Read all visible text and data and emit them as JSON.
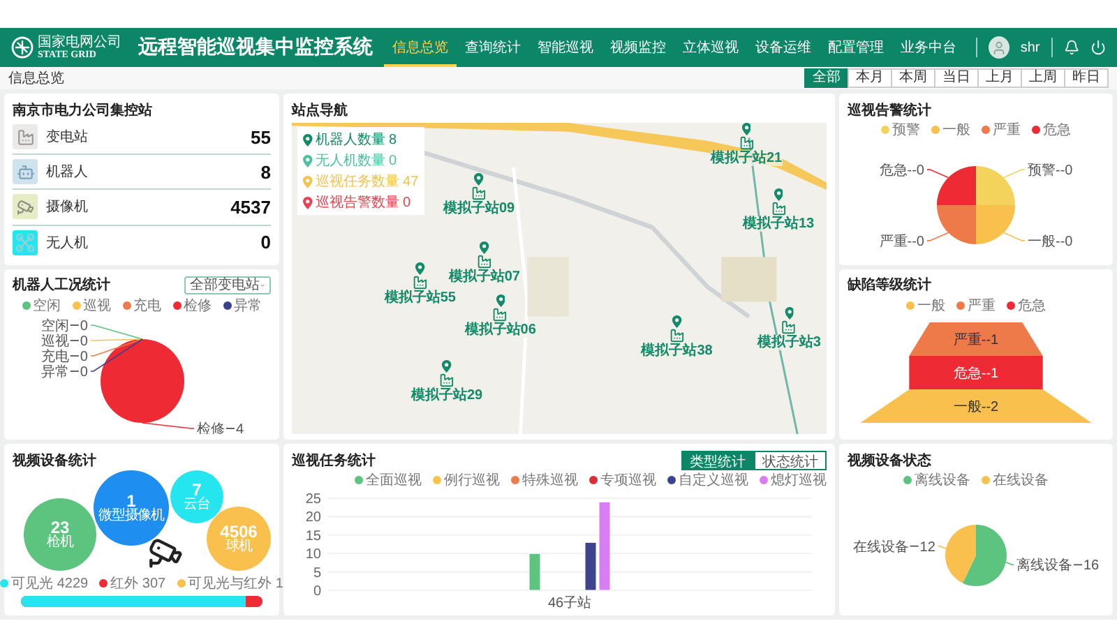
{
  "header": {
    "logo_cn": "国家电网公司",
    "logo_en": "STATE GRID",
    "title": "远程智能巡视集中监控系统",
    "user": "shr",
    "nav": [
      {
        "label": "信息总览",
        "selected": true
      },
      {
        "label": "查询统计",
        "selected": false
      },
      {
        "label": "智能巡视",
        "selected": false
      },
      {
        "label": "视频监控",
        "selected": false
      },
      {
        "label": "立体巡视",
        "selected": false
      },
      {
        "label": "设备运维",
        "selected": false
      },
      {
        "label": "配置管理",
        "selected": false
      },
      {
        "label": "业务中台",
        "selected": false
      }
    ]
  },
  "breadcrumb": "信息总览",
  "time_tabs": [
    {
      "label": "全部",
      "selected": true
    },
    {
      "label": "本月",
      "selected": false
    },
    {
      "label": "本周",
      "selected": false
    },
    {
      "label": "当日",
      "selected": false
    },
    {
      "label": "上月",
      "selected": false
    },
    {
      "label": "上周",
      "selected": false
    },
    {
      "label": "昨日",
      "selected": false
    }
  ],
  "station_summary": {
    "title": "南京市电力公司集控站",
    "items": [
      {
        "kind": "substation",
        "label": "变电站",
        "count": "55"
      },
      {
        "kind": "robot",
        "label": "机器人",
        "count": "8"
      },
      {
        "kind": "camera",
        "label": "摄像机",
        "count": "4537"
      },
      {
        "kind": "drone",
        "label": "无人机",
        "count": "0"
      }
    ]
  },
  "robot_status": {
    "title": "机器人工况统计",
    "filter": "全部变电站",
    "legend": [
      {
        "label": "空闲",
        "color": "#5cc47e"
      },
      {
        "label": "巡视",
        "color": "#f7c34d"
      },
      {
        "label": "充电",
        "color": "#ee7b4b"
      },
      {
        "label": "检修",
        "color": "#ee2a34"
      },
      {
        "label": "异常",
        "color": "#3b3f8f"
      }
    ],
    "chart_data": {
      "type": "pie",
      "categories": [
        "空闲",
        "巡视",
        "充电",
        "检修",
        "异常"
      ],
      "values": [
        0,
        0,
        0,
        4,
        0
      ],
      "value_labels": [
        "0",
        "0",
        "0",
        "4",
        "0"
      ]
    }
  },
  "video_devices": {
    "title": "视频设备统计",
    "bubbles": [
      {
        "value": "1",
        "label": "微型摄像机",
        "color": "#1e8ff0"
      },
      {
        "value": "23",
        "label": "枪机",
        "color": "#5cc47e"
      },
      {
        "value": "7",
        "label": "云台",
        "color": "#25e6ee"
      },
      {
        "value": "4506",
        "label": "球机",
        "color": "#f9c04e"
      }
    ],
    "legend": [
      {
        "label": "可见光 4229",
        "color": "#25e6ee"
      },
      {
        "label": "红外 307",
        "color": "#ee2a34"
      },
      {
        "label": "可见光与红外 1",
        "color": "#f9c04e"
      }
    ],
    "ratio_bar": {
      "level": 0.93
    }
  },
  "site_map": {
    "title": "站点导航",
    "legend": [
      {
        "label": "机器人数量 8",
        "color": "#138a68"
      },
      {
        "label": "无人机数量 0",
        "color": "#4fc0a0"
      },
      {
        "label": "巡视任务数量 47",
        "color": "#f3c24f"
      },
      {
        "label": "巡视告警数量 0",
        "color": "#e6434f"
      }
    ],
    "markers": [
      {
        "label": "模拟子站21"
      },
      {
        "label": "模拟子站13"
      },
      {
        "label": "模拟子站09"
      },
      {
        "label": "模拟子站55"
      },
      {
        "label": "模拟子站07"
      },
      {
        "label": "模拟子站06"
      },
      {
        "label": "模拟子站38"
      },
      {
        "label": "模拟子站3"
      },
      {
        "label": "模拟子站29"
      }
    ]
  },
  "patrol_tasks": {
    "title": "巡视任务统计",
    "toggle": [
      {
        "label": "类型统计",
        "selected": true
      },
      {
        "label": "状态统计",
        "selected": false
      }
    ],
    "chart_data": {
      "type": "bar",
      "categories": [
        "46子站"
      ],
      "grid": true,
      "ylim": [
        0,
        25
      ],
      "yticks": [
        0,
        5,
        10,
        15,
        20,
        25
      ],
      "series": [
        {
          "name": "全面巡视",
          "color": "#5cc47e",
          "values": [
            10
          ]
        },
        {
          "name": "例行巡视",
          "color": "#f7c34d",
          "values": [
            0
          ]
        },
        {
          "name": "特殊巡视",
          "color": "#ee7b4b",
          "values": [
            0
          ]
        },
        {
          "name": "专项巡视",
          "color": "#d92e3a",
          "values": [
            0
          ]
        },
        {
          "name": "自定义巡视",
          "color": "#3f438f",
          "values": [
            13
          ]
        },
        {
          "name": "熄灯巡视",
          "color": "#d97df5",
          "values": [
            24
          ]
        }
      ]
    }
  },
  "alarm_stats": {
    "title": "巡视告警统计",
    "legend": [
      {
        "label": "预警",
        "color": "#f3d35b"
      },
      {
        "label": "一般",
        "color": "#f9c04e"
      },
      {
        "label": "严重",
        "color": "#ee7a4a"
      },
      {
        "label": "危急",
        "color": "#ee2a34"
      }
    ],
    "pie_slices": [
      {
        "label": "危急--0",
        "color": "#ee2a34"
      },
      {
        "label": "预警--0",
        "color": "#f3d35b"
      },
      {
        "label": "严重--0",
        "color": "#ee7a4a"
      },
      {
        "label": "一般--0",
        "color": "#f9c04e"
      }
    ]
  },
  "defect_levels": {
    "title": "缺陷等级统计",
    "legend": [
      {
        "label": "一般",
        "color": "#f9c04e"
      },
      {
        "label": "严重",
        "color": "#ee7a4a"
      },
      {
        "label": "危急",
        "color": "#ee2a34"
      }
    ],
    "layers": [
      {
        "label": "严重--1",
        "color": "#ee7a4a"
      },
      {
        "label": "危急--1",
        "color": "#ee2a34"
      },
      {
        "label": "一般--2",
        "color": "#f9c04e"
      }
    ]
  },
  "device_status": {
    "title": "视频设备状态",
    "legend": [
      {
        "label": "离线设备",
        "color": "#5cc47e"
      },
      {
        "label": "在线设备",
        "color": "#f9c04e"
      }
    ],
    "chart_data": {
      "type": "pie",
      "categories": [
        "离线设备",
        "在线设备"
      ],
      "values": [
        16,
        12
      ],
      "value_labels": [
        "16",
        "12"
      ]
    }
  }
}
